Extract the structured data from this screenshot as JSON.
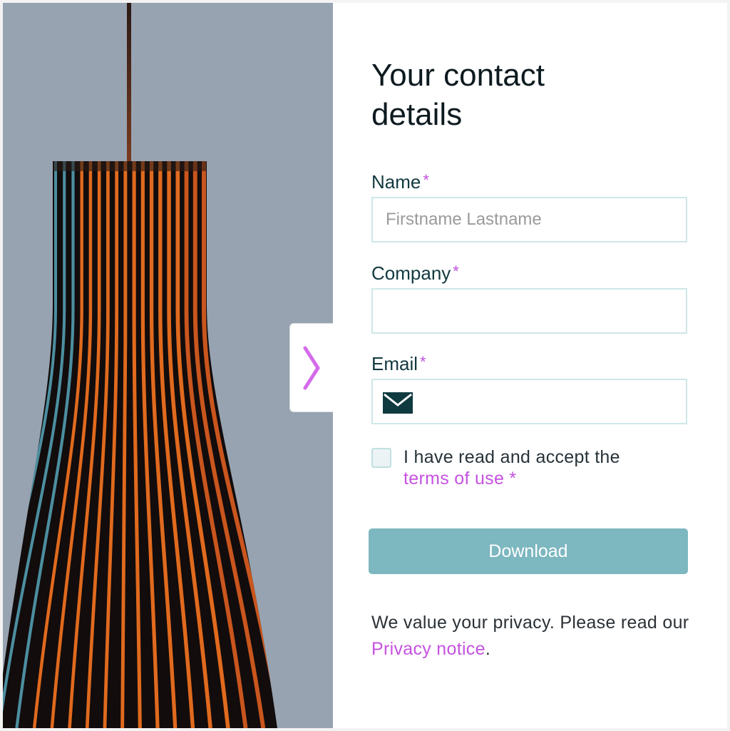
{
  "form": {
    "title": "Your contact details",
    "required_marker": "*",
    "name": {
      "label": "Name",
      "placeholder": "Firstname Lastname",
      "value": ""
    },
    "company": {
      "label": "Company",
      "placeholder": "",
      "value": ""
    },
    "email": {
      "label": "Email",
      "placeholder": "",
      "value": "",
      "icon": "envelope-icon"
    },
    "terms": {
      "checked": false,
      "text": "I have read and accept the",
      "link_label": "terms of use",
      "required_marker": "*"
    },
    "submit_label": "Download",
    "privacy": {
      "text_before": "We value your privacy. Please read our",
      "link_label": "Privacy notice",
      "text_after": "."
    }
  },
  "panel_toggle": {
    "icon": "chevron-right-icon"
  },
  "hero_image": {
    "subject": "lamp-photo"
  },
  "colors": {
    "accent": "#c552e0",
    "button": "#7db7c0",
    "field_border": "#cfe7e8",
    "icon_dark": "#0f3b40"
  }
}
